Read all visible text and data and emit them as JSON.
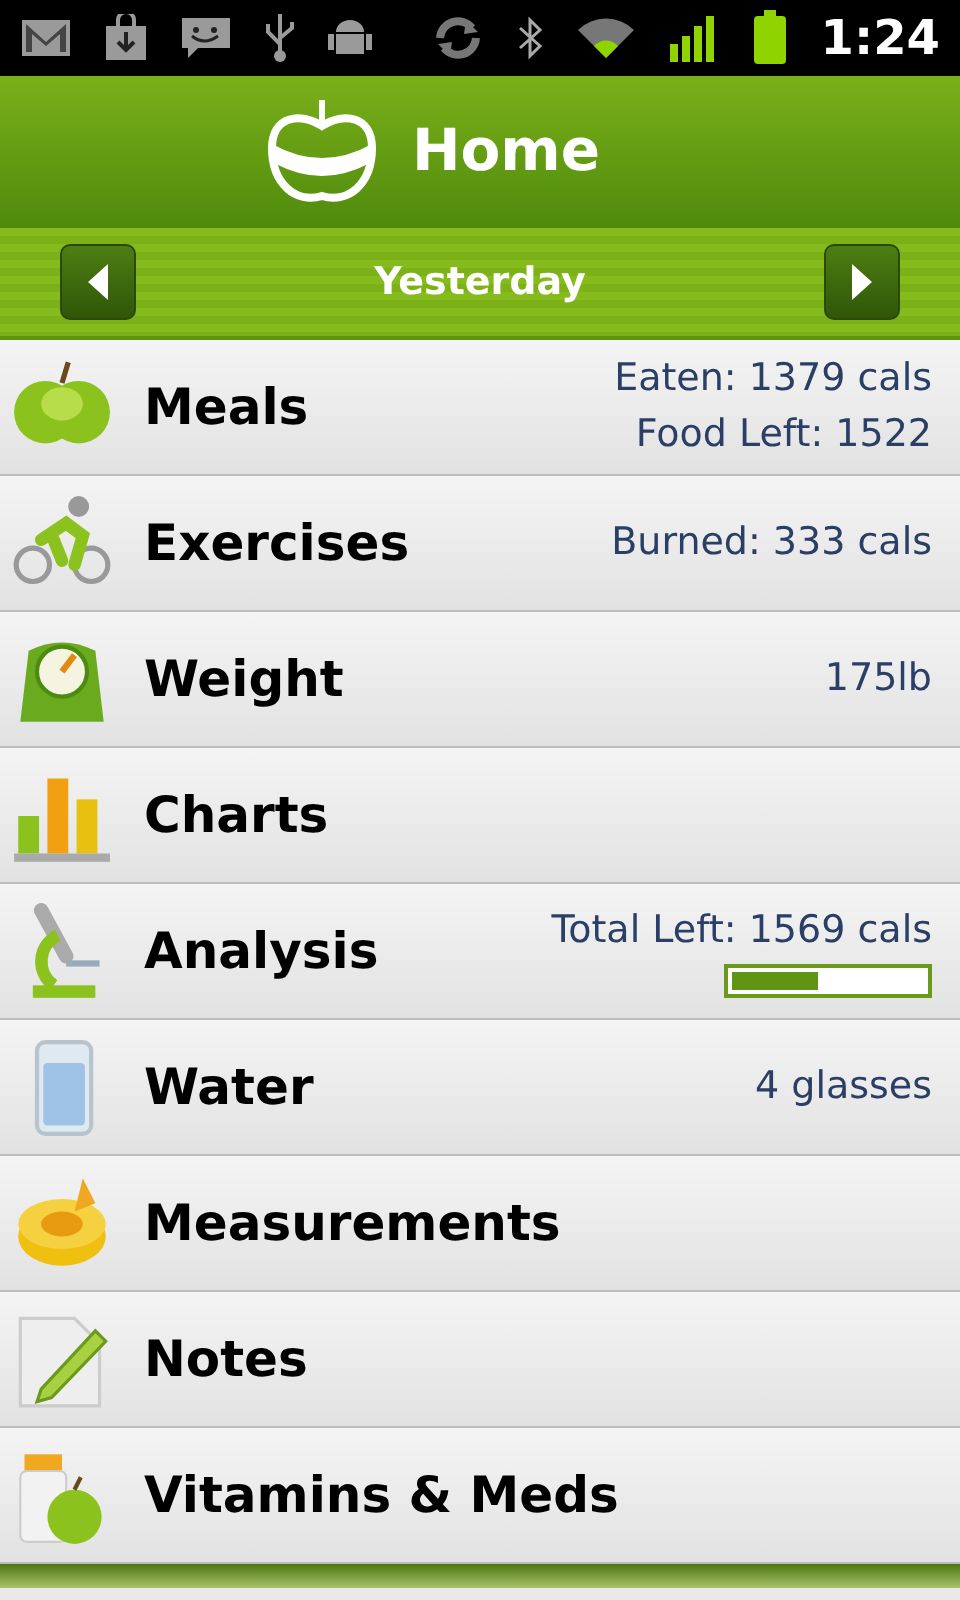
{
  "status_bar": {
    "time": "1:24"
  },
  "header": {
    "title": "Home"
  },
  "date_nav": {
    "label": "Yesterday"
  },
  "items": [
    {
      "label": "Meals",
      "details": [
        "Eaten: 1379 cals",
        "Food Left: 1522"
      ]
    },
    {
      "label": "Exercises",
      "details": [
        "Burned: 333 cals"
      ]
    },
    {
      "label": "Weight",
      "details": [
        "175lb"
      ]
    },
    {
      "label": "Charts"
    },
    {
      "label": "Analysis",
      "details": [
        "Total Left: 1569 cals"
      ],
      "level": 0.45
    },
    {
      "label": "Water",
      "details": [
        "4 glasses"
      ]
    },
    {
      "label": "Measurements"
    },
    {
      "label": "Notes"
    },
    {
      "label": "Vitamins & Meds"
    }
  ]
}
